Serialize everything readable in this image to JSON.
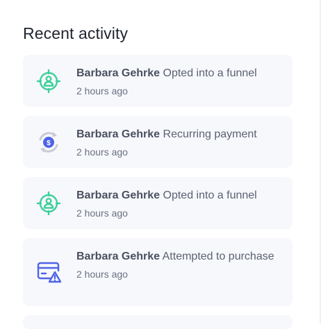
{
  "header": {
    "title": "Recent activity"
  },
  "activities": [
    {
      "name": "Barbara Gehrke",
      "action": "Opted into a funnel",
      "time": "2 hours ago",
      "icon": "funnel-target-icon"
    },
    {
      "name": "Barbara Gehrke",
      "action": "Recurring payment",
      "time": "2 hours ago",
      "icon": "recurring-payment-icon"
    },
    {
      "name": "Barbara Gehrke",
      "action": "Opted into a funnel",
      "time": "2 hours ago",
      "icon": "funnel-target-icon"
    },
    {
      "name": "Barbara Gehrke",
      "action": "Attempted to purchase",
      "time": "2 hours ago",
      "icon": "card-warning-icon"
    }
  ],
  "colors": {
    "funnel_icon": "#3ecf9b",
    "payment_icon": "#c7cbd6",
    "payment_coin": "#4f63e8",
    "card_icon": "#4f63e8"
  }
}
